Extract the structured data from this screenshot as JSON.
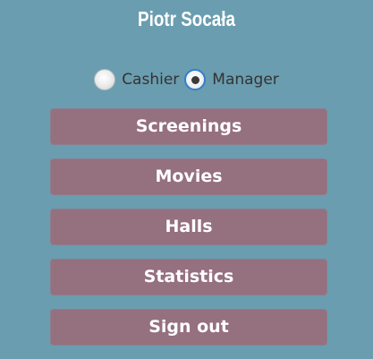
{
  "user": {
    "name": "Piotr Socała"
  },
  "roles": {
    "options": [
      {
        "label": "Cashier",
        "selected": false
      },
      {
        "label": "Manager",
        "selected": true
      }
    ],
    "selected": "Manager"
  },
  "menu": {
    "items": [
      {
        "label": "Screenings"
      },
      {
        "label": "Movies"
      },
      {
        "label": "Halls"
      },
      {
        "label": "Statistics"
      },
      {
        "label": "Sign out"
      }
    ]
  },
  "colors": {
    "background": "#6a9daf",
    "button": "#95707f",
    "button_text": "#ffffff",
    "radio_selected_ring": "#2f7fcf"
  }
}
